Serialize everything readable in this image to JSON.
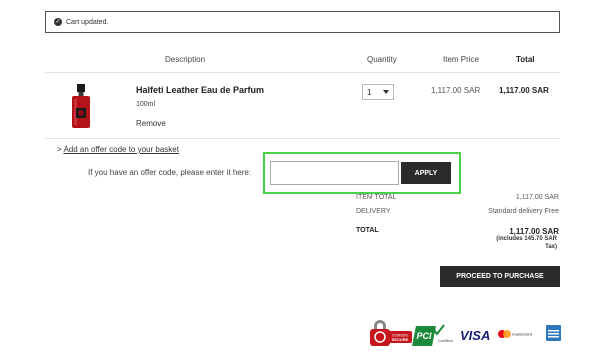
{
  "alert": {
    "message": "Cart updated."
  },
  "table": {
    "headers": {
      "description": "Description",
      "quantity": "Quantity",
      "item_price": "Item Price",
      "total": "Total"
    }
  },
  "item": {
    "name": "Halfeti Leather Eau de Parfum",
    "size": "100ml",
    "remove_label": "Remove",
    "quantity": "1",
    "item_price": "1,117.00 SAR",
    "total": "1,117.00 SAR"
  },
  "offer": {
    "link_prefix": ">",
    "link_text": "Add an offer code to your basket",
    "prompt": "If you have an offer code, please enter it here:",
    "input_value": "",
    "apply_label": "APPLY"
  },
  "summary": {
    "item_total_label": "ITEM TOTAL",
    "item_total_value": "1,117.00 SAR",
    "delivery_label": "DELIVERY",
    "delivery_value": "Standard delivery Free",
    "total_label": "TOTAL",
    "total_value": "1,117.00 SAR",
    "tax_line1": "(includes 145.70 SAR",
    "tax_line2": "Tax)"
  },
  "proceed_label": "PROCEED TO PURCHASE",
  "badges": {
    "comodo_line1": "COMODO",
    "comodo_line2": "SECURE",
    "pci": "PCI",
    "pci_sub": "Certified",
    "visa": "VISA",
    "mastercard": "mastercard"
  },
  "colors": {
    "accent_dark": "#2b2b2b",
    "highlight": "#4ad14a",
    "comodo_red": "#c4161c",
    "pci_green": "#1a8a3a",
    "visa_blue": "#1a1f71",
    "amex_blue": "#2e77bb"
  }
}
